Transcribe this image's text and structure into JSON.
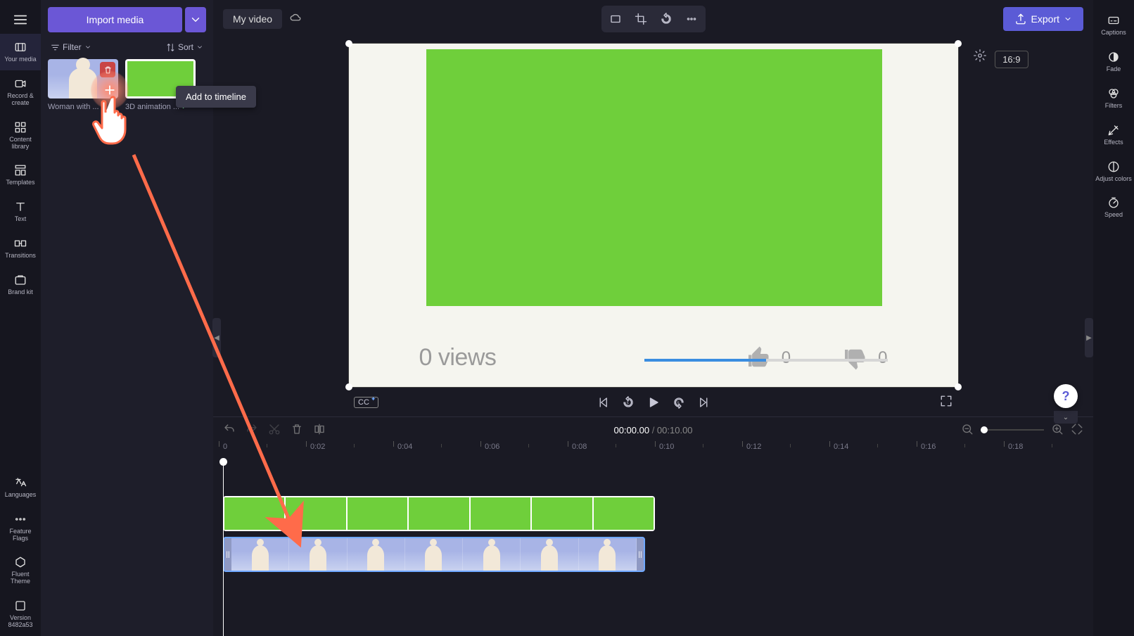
{
  "topbar": {
    "title": "My video",
    "export_label": "Export",
    "aspect_ratio": "16:9"
  },
  "import": {
    "button": "Import media"
  },
  "filters": {
    "filter_label": "Filter",
    "sort_label": "Sort"
  },
  "media": {
    "items": [
      {
        "label": "Woman with ..."
      },
      {
        "label": "3D animation ..."
      }
    ],
    "tooltip": "Add to timeline"
  },
  "left_rail": {
    "items": [
      "Your media",
      "Record & create",
      "Content library",
      "Templates",
      "Text",
      "Transitions",
      "Brand kit"
    ],
    "bottom": [
      "Languages",
      "Feature Flags",
      "Fluent Theme",
      "Version 8482a53"
    ]
  },
  "right_rail": {
    "items": [
      "Captions",
      "Fade",
      "Filters",
      "Effects",
      "Adjust colors",
      "Speed"
    ]
  },
  "preview": {
    "views_text": "0 views",
    "like_count": "0",
    "dislike_count": "0"
  },
  "playback": {
    "cc_label": "CC"
  },
  "timeline": {
    "current": "00:00.00",
    "total": "00:10.00",
    "ticks": [
      "0",
      "0:02",
      "0:04",
      "0:06",
      "0:08",
      "0:10",
      "0:12",
      "0:14",
      "0:16",
      "0:18"
    ]
  },
  "help": {
    "label": "?"
  }
}
